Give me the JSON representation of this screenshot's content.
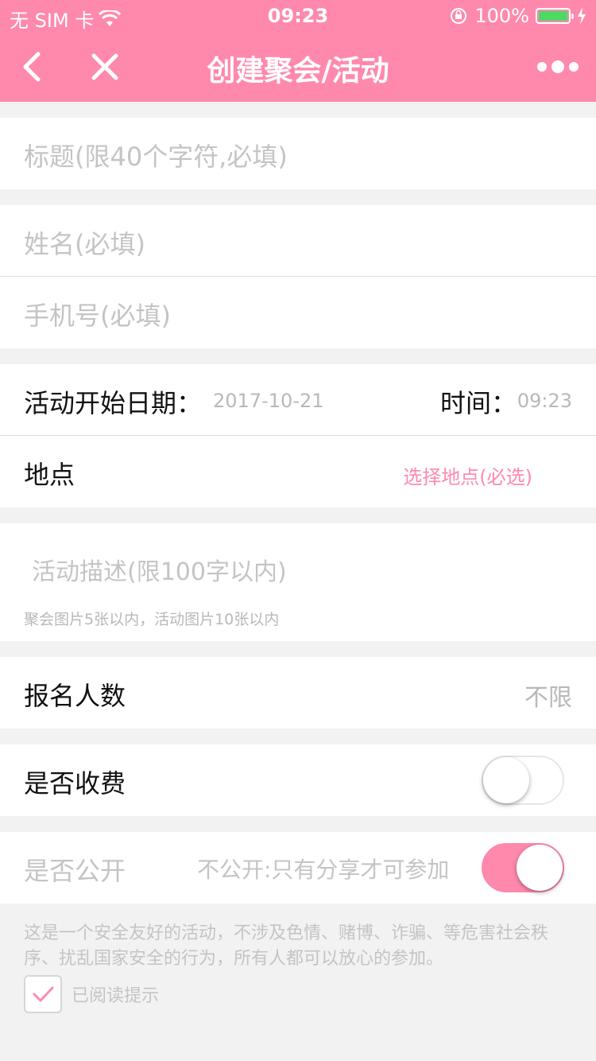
{
  "status_bar": {
    "carrier": "无 SIM 卡",
    "time": "09:23",
    "battery": "100%",
    "battery_level": 1.0
  },
  "nav": {
    "title": "创建聚会/活动"
  },
  "form": {
    "title_placeholder": "标题(限40个字符,必填)",
    "name_placeholder": "姓名(必填)",
    "phone_placeholder": "手机号(必填)",
    "start_date_label": "活动开始日期：",
    "start_date_value": "2017-10-21",
    "time_label": "时间：",
    "time_value": "09:23",
    "location_label": "地点",
    "location_action": "选择地点(必选)",
    "description_placeholder": "活动描述(限100字以内)",
    "image_hint": "聚会图片5张以内，活动图片10张以内",
    "participants_label": "报名人数",
    "participants_value": "不限",
    "fee_label": "是否收费",
    "fee_on": false,
    "public_label": "是否公开",
    "public_hint": "不公开:只有分享才可参加",
    "public_on": true
  },
  "notice": {
    "text": "这是一个安全友好的活动，不涉及色情、赌博、诈骗、等危害社会秩序、扰乱国家安全的行为，所有人都可以放心的参加。",
    "checkbox_label": "已阅读提示",
    "checked": true
  },
  "colors": {
    "accent": "#ff89ad",
    "battery": "#4cd964"
  }
}
